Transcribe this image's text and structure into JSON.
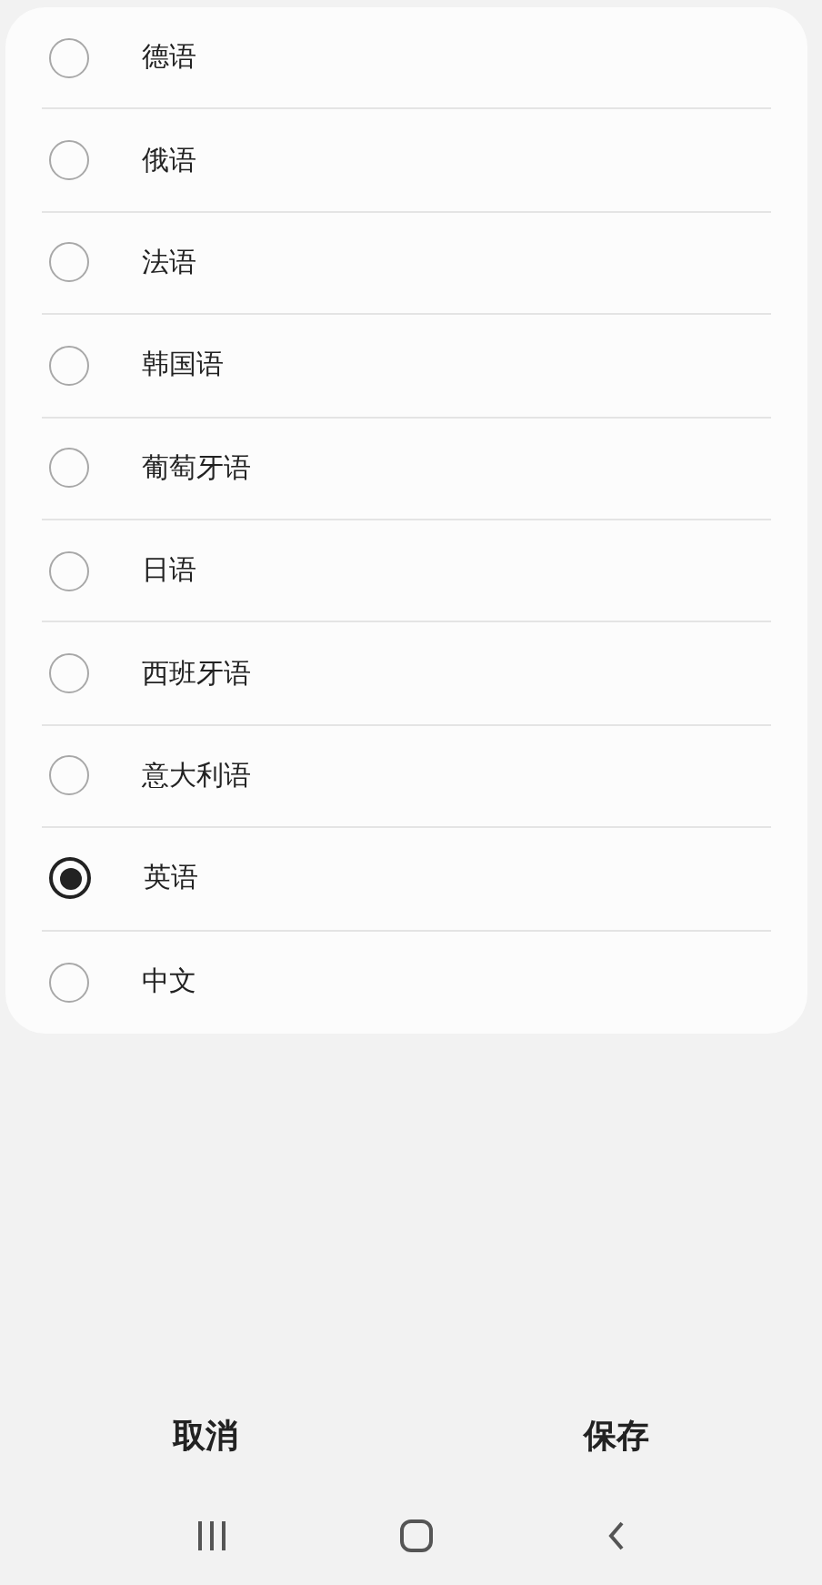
{
  "languages": [
    {
      "label": "德语",
      "selected": false
    },
    {
      "label": "俄语",
      "selected": false
    },
    {
      "label": "法语",
      "selected": false
    },
    {
      "label": "韩国语",
      "selected": false
    },
    {
      "label": "葡萄牙语",
      "selected": false
    },
    {
      "label": "日语",
      "selected": false
    },
    {
      "label": "西班牙语",
      "selected": false
    },
    {
      "label": "意大利语",
      "selected": false
    },
    {
      "label": "英语",
      "selected": true
    },
    {
      "label": "中文",
      "selected": false
    }
  ],
  "buttons": [
    {
      "label": "取消"
    },
    {
      "label": "保存"
    }
  ]
}
